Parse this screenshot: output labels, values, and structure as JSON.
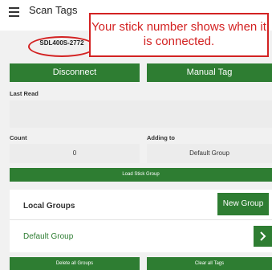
{
  "header": {
    "title": "Scan Tags",
    "menu_icon": "hamburger-menu-icon"
  },
  "stick": {
    "number": "SDL400S-2772"
  },
  "annotation": {
    "text": "Your stick number shows when it is connected."
  },
  "actions": {
    "disconnect_label": "Disconnect",
    "manual_tag_label": "Manual Tag",
    "load_stick_group_label": "Load Stick Group",
    "delete_all_groups_label": "Delete all Groups",
    "clear_all_tags_label": "Clear all Tags"
  },
  "last_read": {
    "label": "Last Read",
    "value": ""
  },
  "count": {
    "label": "Count",
    "value": "0"
  },
  "adding_to": {
    "label": "Adding to",
    "value": "Default Group"
  },
  "local_groups": {
    "title": "Local Groups",
    "new_group_label": "New Group",
    "items": [
      {
        "name": "Default Group",
        "icon": "chevron-right-icon"
      }
    ]
  },
  "colors": {
    "primary_green": "#2e7d32",
    "annotation_red": "#d32222",
    "field_background": "#ececec",
    "page_background": "#f1f1f1"
  }
}
